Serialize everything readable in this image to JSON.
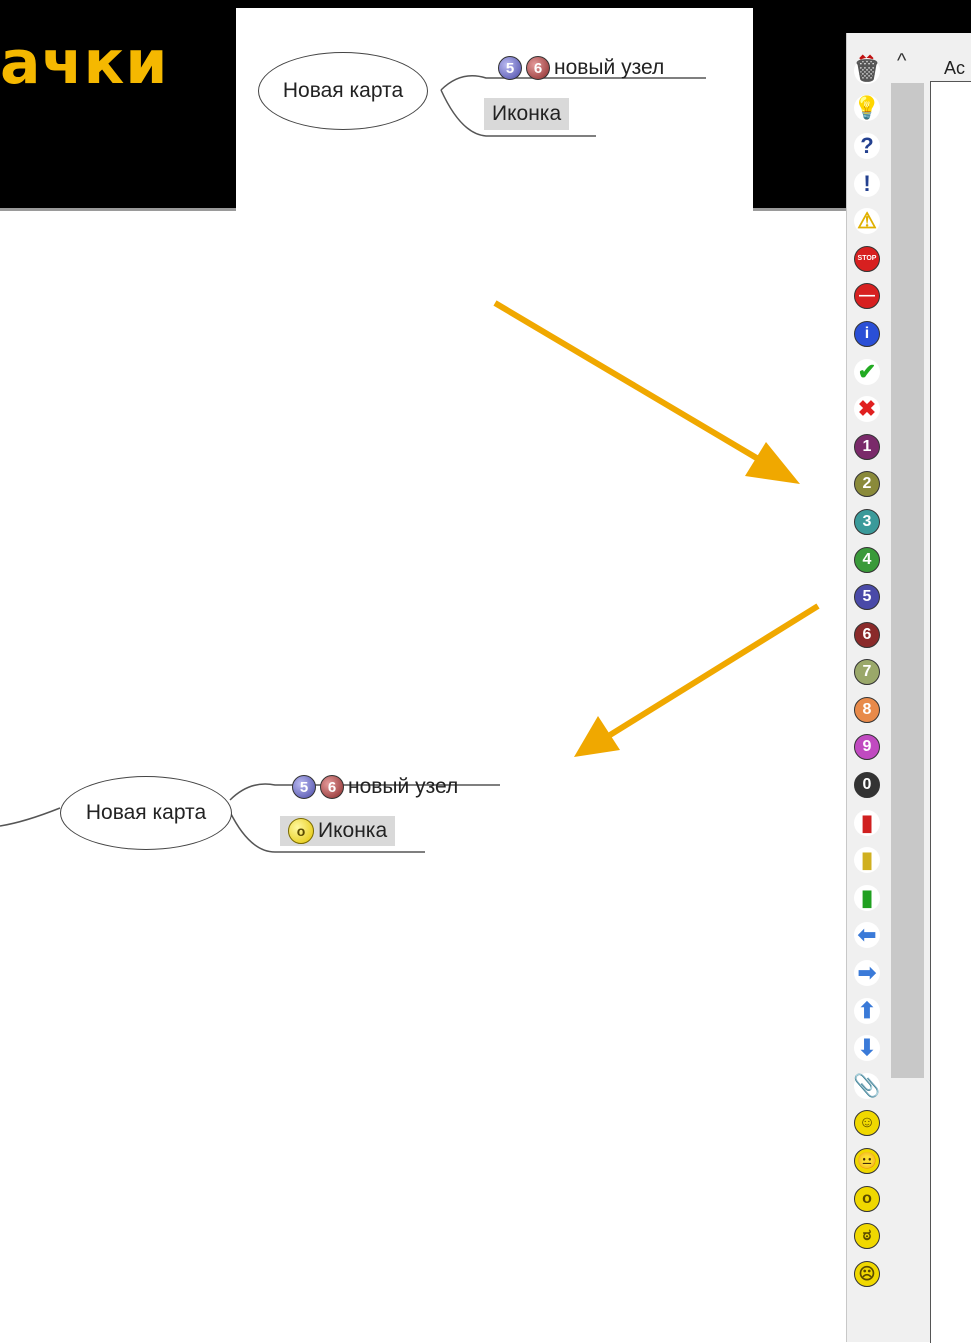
{
  "slide_title": "ачки",
  "top_map": {
    "root": "Новая карта",
    "child1": "новый узел",
    "child2": "Иконка",
    "badges": [
      "5",
      "6"
    ]
  },
  "bottom_map": {
    "root": "Новая карта",
    "child1": "новый узел",
    "child2": "Иконка",
    "badges": [
      "5",
      "6"
    ]
  },
  "panel": {
    "tab_label": "Ac",
    "close_glyph": "✖",
    "up_glyph": "^"
  },
  "icons": [
    {
      "name": "trash-icon",
      "glyph": "🗑",
      "bg": "#ffffff",
      "fg": "#555"
    },
    {
      "name": "lightbulb-icon",
      "glyph": "💡",
      "bg": "#ffffff",
      "fg": "#e6c800"
    },
    {
      "name": "question-icon",
      "glyph": "?",
      "bg": "#ffffff",
      "fg": "#23408f"
    },
    {
      "name": "exclamation-icon",
      "glyph": "!",
      "bg": "#ffffff",
      "fg": "#23408f"
    },
    {
      "name": "warning-icon",
      "glyph": "⚠",
      "bg": "#ffffff",
      "fg": "#e0b000"
    },
    {
      "name": "stop-icon",
      "glyph": "STOP",
      "bg": "#d72020",
      "fg": "#fff"
    },
    {
      "name": "no-entry-icon",
      "glyph": "—",
      "bg": "#d72020",
      "fg": "#fff"
    },
    {
      "name": "info-icon",
      "glyph": "i",
      "bg": "#2a4fd6",
      "fg": "#fff"
    },
    {
      "name": "check-icon",
      "glyph": "✔",
      "bg": "#ffffff",
      "fg": "#22aa22"
    },
    {
      "name": "cross-icon",
      "glyph": "✖",
      "bg": "#ffffff",
      "fg": "#e02020"
    },
    {
      "name": "number-1-icon",
      "glyph": "1",
      "bg": "#7a2a6a",
      "fg": "#fff"
    },
    {
      "name": "number-2-icon",
      "glyph": "2",
      "bg": "#8a8a3a",
      "fg": "#fff"
    },
    {
      "name": "number-3-icon",
      "glyph": "3",
      "bg": "#3a9a9a",
      "fg": "#fff"
    },
    {
      "name": "number-4-icon",
      "glyph": "4",
      "bg": "#3a9a3a",
      "fg": "#fff"
    },
    {
      "name": "number-5-icon",
      "glyph": "5",
      "bg": "#4a4aa8",
      "fg": "#fff"
    },
    {
      "name": "number-6-icon",
      "glyph": "6",
      "bg": "#8a2a2a",
      "fg": "#fff"
    },
    {
      "name": "number-7-icon",
      "glyph": "7",
      "bg": "#9aa86a",
      "fg": "#fff"
    },
    {
      "name": "number-8-icon",
      "glyph": "8",
      "bg": "#e88a4a",
      "fg": "#fff"
    },
    {
      "name": "number-9-icon",
      "glyph": "9",
      "bg": "#c04ac0",
      "fg": "#fff"
    },
    {
      "name": "number-0-icon",
      "glyph": "0",
      "bg": "#333333",
      "fg": "#fff"
    },
    {
      "name": "traffic-light-red-icon",
      "glyph": "▮",
      "bg": "#ffffff",
      "fg": "#d02020"
    },
    {
      "name": "traffic-light-yellow-icon",
      "glyph": "▮",
      "bg": "#ffffff",
      "fg": "#d0b020"
    },
    {
      "name": "traffic-light-green-icon",
      "glyph": "▮",
      "bg": "#ffffff",
      "fg": "#20a020"
    },
    {
      "name": "arrow-left-icon",
      "glyph": "⬅",
      "bg": "#ffffff",
      "fg": "#3a7ad8"
    },
    {
      "name": "arrow-right-icon",
      "glyph": "➡",
      "bg": "#ffffff",
      "fg": "#3a7ad8"
    },
    {
      "name": "arrow-up-icon",
      "glyph": "⬆",
      "bg": "#ffffff",
      "fg": "#3a7ad8"
    },
    {
      "name": "arrow-down-icon",
      "glyph": "⬇",
      "bg": "#ffffff",
      "fg": "#3a7ad8"
    },
    {
      "name": "paperclip-icon",
      "glyph": "📎",
      "bg": "#ffffff",
      "fg": "#333"
    },
    {
      "name": "smiley-happy-icon",
      "glyph": "☺",
      "bg": "#f0d800",
      "fg": "#5a4a00"
    },
    {
      "name": "smiley-neutral-icon",
      "glyph": "😐",
      "bg": "#f0d800",
      "fg": "#5a4a00"
    },
    {
      "name": "smiley-surprised-icon",
      "glyph": "o",
      "bg": "#f0d800",
      "fg": "#5a4a00"
    },
    {
      "name": "smiley-angry-icon",
      "glyph": "ಠ",
      "bg": "#f0d800",
      "fg": "#5a4a00"
    },
    {
      "name": "smiley-sad-icon",
      "glyph": "☹",
      "bg": "#f0d800",
      "fg": "#5a4a00"
    }
  ],
  "colors": {
    "accent": "#f5b800",
    "arrow": "#f0a800"
  }
}
